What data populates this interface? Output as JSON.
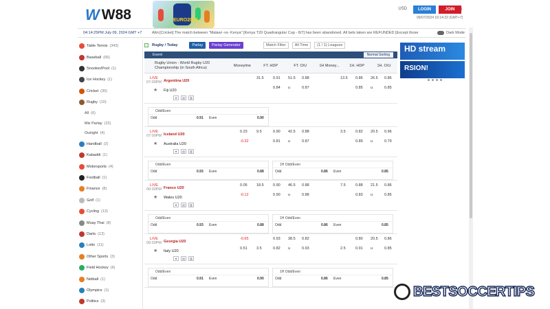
{
  "header": {
    "brand_mark": "W",
    "brand": "W88",
    "euro_text": "EURO2024",
    "currency": "USD",
    "login": "LOGIN",
    "join": "JOIN",
    "server_time": "09/07/2024 16:14:22 (GMT+7)"
  },
  "bar": {
    "local_time": "04:14:25PM July 09, 2024 GMT +7",
    "announcement": "Attn:[Cricket] The match between \"Malawi -vs- Kenya\" [Kenya T20 Quadrangular Cup - 8/7] has been abandoned. All bets taken are REFUNDED [Except those",
    "dark_mode": "Dark Mode"
  },
  "sidebar": {
    "items": [
      {
        "label": "Table Tennis",
        "count": "(343)",
        "color": "#e74c3c"
      },
      {
        "label": "Baseball",
        "count": "(66)",
        "color": "#c0392b"
      },
      {
        "label": "Snooker/Pool",
        "count": "(1)",
        "color": "#333"
      },
      {
        "label": "Ice Hockey",
        "count": "(1)",
        "color": "#444"
      },
      {
        "label": "Cricket",
        "count": "(30)",
        "color": "#d35400"
      },
      {
        "label": "Rugby",
        "count": "(10)",
        "color": "#8e5a2b"
      }
    ],
    "sub": [
      {
        "label": "All",
        "count": "(6)"
      },
      {
        "label": "Mix Parlay",
        "count": "(22)"
      },
      {
        "label": "Outright",
        "count": "(4)"
      }
    ],
    "items2": [
      {
        "label": "Handball",
        "count": "(2)",
        "color": "#2980b9"
      },
      {
        "label": "Kabaddi",
        "count": "(1)",
        "color": "#c0392b"
      },
      {
        "label": "Motorsports",
        "count": "(4)",
        "color": "#e74c3c"
      },
      {
        "label": "Football",
        "count": "(1)",
        "color": "#222"
      },
      {
        "label": "Finance",
        "count": "(8)",
        "color": "#e67e22"
      },
      {
        "label": "Golf",
        "count": "(1)",
        "color": "#bbb"
      },
      {
        "label": "Cycling",
        "count": "(13)",
        "color": "#e74c3c"
      },
      {
        "label": "Muay Thai",
        "count": "(8)",
        "color": "#888"
      },
      {
        "label": "Darts",
        "count": "(13)",
        "color": "#c0392b"
      },
      {
        "label": "Lotto",
        "count": "(11)",
        "color": "#2980b9"
      },
      {
        "label": "Other Sports",
        "count": "(3)",
        "color": "#e67e22"
      },
      {
        "label": "Field Hockey",
        "count": "(6)",
        "color": "#27ae60"
      },
      {
        "label": "Netball",
        "count": "(1)",
        "color": "#e67e22"
      },
      {
        "label": "Olympics",
        "count": "(1)",
        "color": "#2980b9"
      },
      {
        "label": "Politics",
        "count": "(3)",
        "color": "#c0392b"
      }
    ]
  },
  "toolbar": {
    "title": "Rugby / Today",
    "parlay": "Parlay",
    "parlay_gen": "Parlay Generator",
    "filter": "Match Filter",
    "time": "All Time",
    "leagues": "(1 / 1) Leagues"
  },
  "event": {
    "label": "Event",
    "sorting": "Normal Sorting",
    "league": "Rugby Union - World Rugby U20 Championship (in South Africa)",
    "cols": [
      "Moneyline",
      "FT. HDP",
      "FT. O/U",
      "1H Money...",
      "1H. HDP",
      "1H. O/U"
    ]
  },
  "matches": [
    {
      "status": "LIVE",
      "time": "07:00PM",
      "home": "Argentina U20",
      "away": "Fiji U20",
      "ml1": "",
      "ml2": "",
      "h1": "31.5",
      "hv1": "0.91",
      "o1": "51.5",
      "ov1": "0.88",
      "h2": "",
      "hv2": "0.84",
      "o2": "u",
      "ov2": "0.87",
      "fh1": "13.5",
      "fhv1": "0.86",
      "fo1": "26.5",
      "fov1": "0.86",
      "fh2": "",
      "fhv2": "0.85",
      "fo2": "u",
      "fov2": "0.85",
      "oe": [
        {
          "title": "Odd/Even",
          "odd": "Odd",
          "oddv": "0.91",
          "even": "Even",
          "evenv": "0.90"
        }
      ]
    },
    {
      "status": "LIVE",
      "time": "07:00PM",
      "home": "Iceland U20",
      "away": "Australia U20",
      "ml1": "0.23",
      "ml2": "-0.32",
      "h1": "9.5",
      "hv1": "0.90",
      "o1": "42.5",
      "ov1": "0.88",
      "h2": "",
      "hv2": "0.81",
      "o2": "u",
      "ov2": "0.87",
      "fh1": "3.5",
      "fhv1": "0.82",
      "fo1": "20.5",
      "fov1": "0.96",
      "fh2": "",
      "fhv2": "0.89",
      "fo2": "u",
      "fov2": "0.79",
      "oe": [
        {
          "title": "Odd/Even",
          "odd": "Odd",
          "oddv": "0.93",
          "even": "Even",
          "evenv": "0.88"
        },
        {
          "title": "1H Odd/Even",
          "odd": "Odd",
          "oddv": "0.86",
          "even": "Even",
          "evenv": "0.85"
        }
      ]
    },
    {
      "status": "LIVE",
      "time": "09:30PM",
      "home": "France U20",
      "away": "Wales U20",
      "ml1": "0.05",
      "ml2": "-0.12",
      "h1": "18.5",
      "hv1": "0.90",
      "o1": "46.5",
      "ov1": "0.88",
      "h2": "",
      "hv2": "0.90",
      "o2": "u",
      "ov2": "0.88",
      "fh1": "7.5",
      "fhv1": "0.88",
      "fo1": "21.5",
      "fov1": "0.86",
      "fh2": "",
      "fhv2": "0.83",
      "fo2": "u",
      "fov2": "0.85",
      "oe": [
        {
          "title": "Odd/Even",
          "odd": "Odd",
          "oddv": "0.93",
          "even": "Even",
          "evenv": "0.88"
        },
        {
          "title": "1H Odd/Even",
          "odd": "Odd",
          "oddv": "0.86",
          "even": "Even",
          "evenv": "0.85"
        }
      ]
    },
    {
      "status": "LIVE",
      "time": "09:30PM",
      "home": "Georgia U20",
      "away": "Italy U20",
      "ml1": "-0.65",
      "ml2": "0.51",
      "h1": "",
      "hv1": "0.93",
      "o1": "38.5",
      "ov1": "0.82",
      "h2": "3.5",
      "hv2": "0.82",
      "o2": "u",
      "ov2": "0.93",
      "fh1": "",
      "fhv1": "0.80",
      "fo1": "20.5",
      "fov1": "0.86",
      "fh2": "2.5",
      "fhv2": "0.91",
      "fo2": "u",
      "fov2": "0.85",
      "oe": [
        {
          "title": "Odd/Even",
          "odd": "Odd",
          "oddv": "0.91",
          "even": "Even",
          "evenv": "0.90"
        },
        {
          "title": "1H Odd/Even",
          "odd": "Odd",
          "oddv": "0.86",
          "even": "Even",
          "evenv": "0.85"
        }
      ]
    }
  ],
  "ads": {
    "a1": "HD stream",
    "a2": "RSION!"
  },
  "watermark": {
    "text": "BESTSOCCERTIPS"
  }
}
